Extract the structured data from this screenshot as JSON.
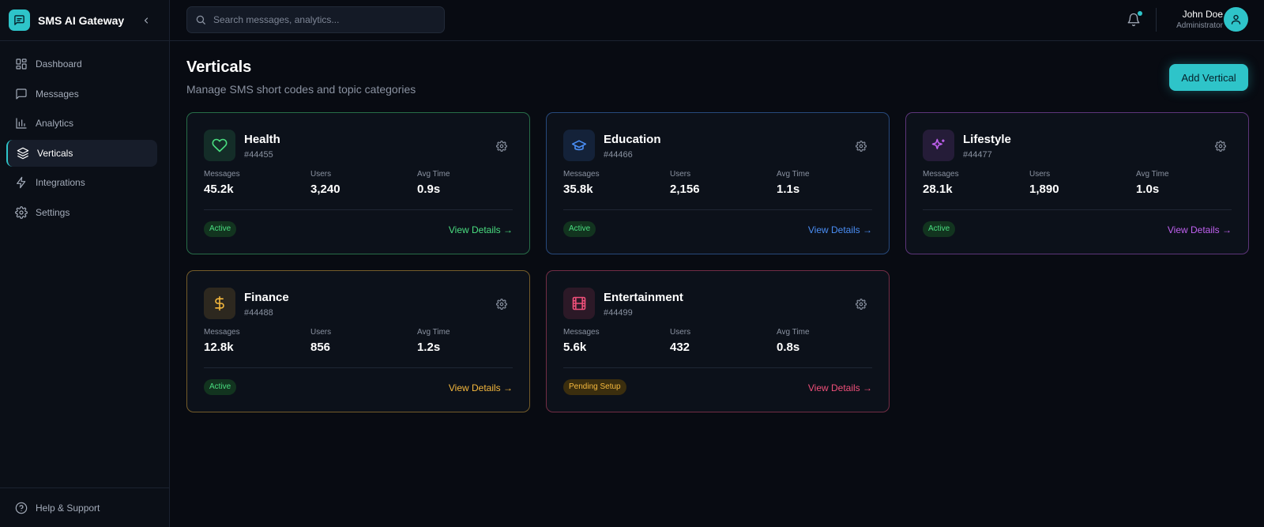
{
  "app": {
    "name": "SMS AI Gateway",
    "accent": "#2ec4c9"
  },
  "sidebar": {
    "items": [
      {
        "label": "Dashboard",
        "icon": "dashboard-icon"
      },
      {
        "label": "Messages",
        "icon": "message-icon"
      },
      {
        "label": "Analytics",
        "icon": "chart-icon"
      },
      {
        "label": "Verticals",
        "icon": "layers-icon",
        "active": true
      },
      {
        "label": "Integrations",
        "icon": "bolt-icon"
      },
      {
        "label": "Settings",
        "icon": "gear-icon"
      }
    ],
    "help_label": "Help & Support"
  },
  "header": {
    "search_placeholder": "Search messages, analytics...",
    "user": {
      "name": "John Doe",
      "role": "Administrator"
    }
  },
  "page": {
    "title": "Verticals",
    "subtitle": "Manage SMS short codes and topic categories",
    "add_button": "Add Vertical"
  },
  "stat_labels": {
    "messages": "Messages",
    "users": "Users",
    "avg_time": "Avg Time"
  },
  "verticals": [
    {
      "name": "Health",
      "code": "#44455",
      "messages": "45.2k",
      "users": "3,240",
      "avg_time": "0.9s",
      "status": "Active",
      "link": "View Details →",
      "icon": "heart-icon",
      "color": "#4ade80"
    },
    {
      "name": "Education",
      "code": "#44466",
      "messages": "35.8k",
      "users": "2,156",
      "avg_time": "1.1s",
      "status": "Active",
      "link": "View Details →",
      "icon": "graduation-cap-icon",
      "color": "#4a8ef5"
    },
    {
      "name": "Lifestyle",
      "code": "#44477",
      "messages": "28.1k",
      "users": "1,890",
      "avg_time": "1.0s",
      "status": "Active",
      "link": "View Details →",
      "icon": "sparkles-icon",
      "color": "#c061f0"
    },
    {
      "name": "Finance",
      "code": "#44488",
      "messages": "12.8k",
      "users": "856",
      "avg_time": "1.2s",
      "status": "Active",
      "link": "View Details →",
      "icon": "dollar-icon",
      "color": "#f5b83d"
    },
    {
      "name": "Entertainment",
      "code": "#44499",
      "messages": "5.6k",
      "users": "432",
      "avg_time": "0.8s",
      "status": "Pending Setup",
      "link": "View Details →",
      "icon": "film-icon",
      "color": "#f0507a"
    }
  ]
}
